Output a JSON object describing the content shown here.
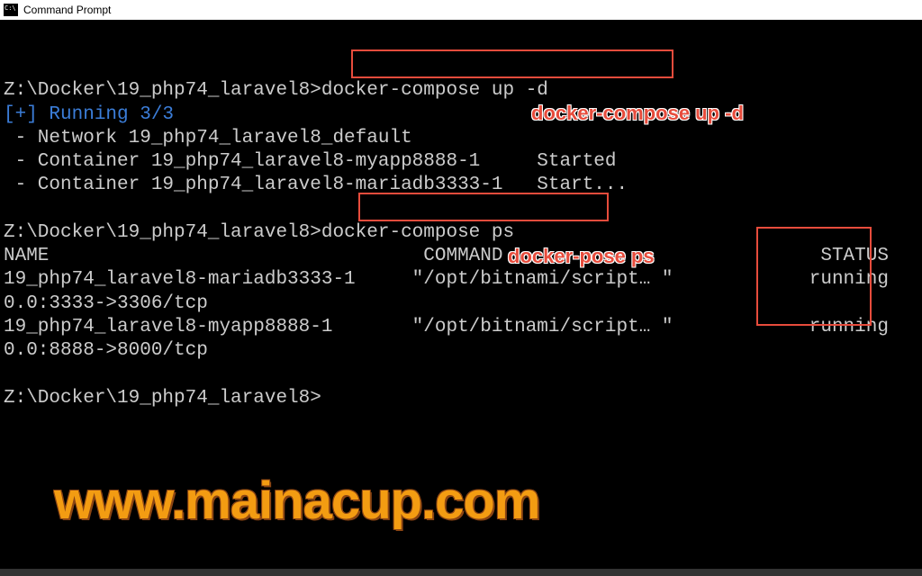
{
  "window": {
    "title": "Command Prompt"
  },
  "terminal": {
    "prompt1_path": "Z:\\Docker\\19_php74_laravel8>",
    "cmd1": "docker-compose up -d",
    "running_prefix": "[+]",
    "running_text": " Running 3/3",
    "line_network": " - Network 19_php74_laravel8_default",
    "line_container1": " - Container 19_php74_laravel8-myapp8888-1     Started",
    "line_container2": " - Container 19_php74_laravel8-mariadb3333-1   Start...",
    "prompt2_path": "Z:\\Docker\\19_php74_laravel8>",
    "cmd2": "docker-compose ps",
    "ps_header": "NAME                                 COMMAND                            STATUS",
    "ps_row1a": "19_php74_laravel8-mariadb3333-1     \"/opt/bitnami/script… \"            running",
    "ps_row1b": "0.0:3333->3306/tcp",
    "ps_row2a": "19_php74_laravel8-myapp8888-1       \"/opt/bitnami/script… \"            running",
    "ps_row2b": "0.0:8888->8000/tcp",
    "prompt3_path": "Z:\\Docker\\19_php74_laravel8>"
  },
  "annotations": {
    "label1": "docker-compose up -d",
    "label2": "docker-pose ps"
  },
  "watermark": "www.mainacup.com"
}
